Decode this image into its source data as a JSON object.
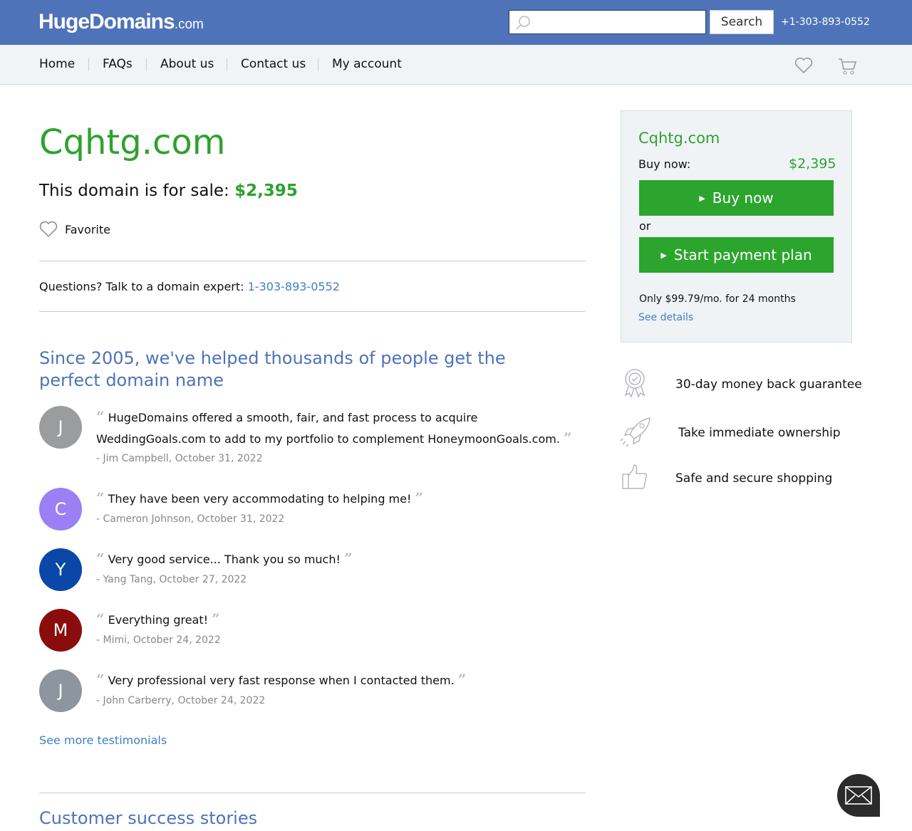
{
  "header": {
    "logo": "HugeDomains",
    "logo_suffix": ".com",
    "search_placeholder": "",
    "search_label": "Search",
    "phone": "+1-303-893-0552"
  },
  "nav": [
    "Home",
    "FAQs",
    "About us",
    "Contact us",
    "My account"
  ],
  "domain": "Cqhtg.com",
  "for_sale_text": "This domain is for sale:",
  "price": "$2,395",
  "favorite": "Favorite",
  "questions": "Questions? Talk to a domain expert:",
  "questions_phone": "1-303-893-0552",
  "since": "Since 2005, we've helped thousands of people get the perfect domain name",
  "testimonials": [
    {
      "initial": "J",
      "color": "#9a9c9e",
      "text": "HugeDomains offered a smooth, fair, and fast process to acquire WeddingGoals.com to add to my portfolio to complement HoneymoonGoals.com.",
      "by": "- Jim Campbell, October 31, 2022"
    },
    {
      "initial": "C",
      "color": "#9b7ff5",
      "text": "They have been very accommodating to helping me!",
      "by": "- Cameron Johnson, October 31, 2022"
    },
    {
      "initial": "Y",
      "color": "#0b47a8",
      "text": "Very good service... Thank you so much!",
      "by": "- Yang Tang, October 27, 2022"
    },
    {
      "initial": "M",
      "color": "#8b0c0c",
      "text": "Everything great!",
      "by": "- Mimi, October 24, 2022"
    },
    {
      "initial": "J",
      "color": "#8d969e",
      "text": "Very professional very fast response when I contacted them.",
      "by": "- John Carberry, October 24, 2022"
    }
  ],
  "see_more": "See more testimonials",
  "stories": "Customer success stories",
  "box": {
    "domain": "Cqhtg.com",
    "buy_now_label": "Buy now:",
    "price": "$2,395",
    "buy_button": "Buy now",
    "or": "or",
    "plan_button": "Start payment plan",
    "only": "Only $99.79/mo. for 24 months",
    "see_details": "See details"
  },
  "features": [
    "30-day money back guarantee",
    "Take immediate ownership",
    "Safe and secure shopping"
  ]
}
